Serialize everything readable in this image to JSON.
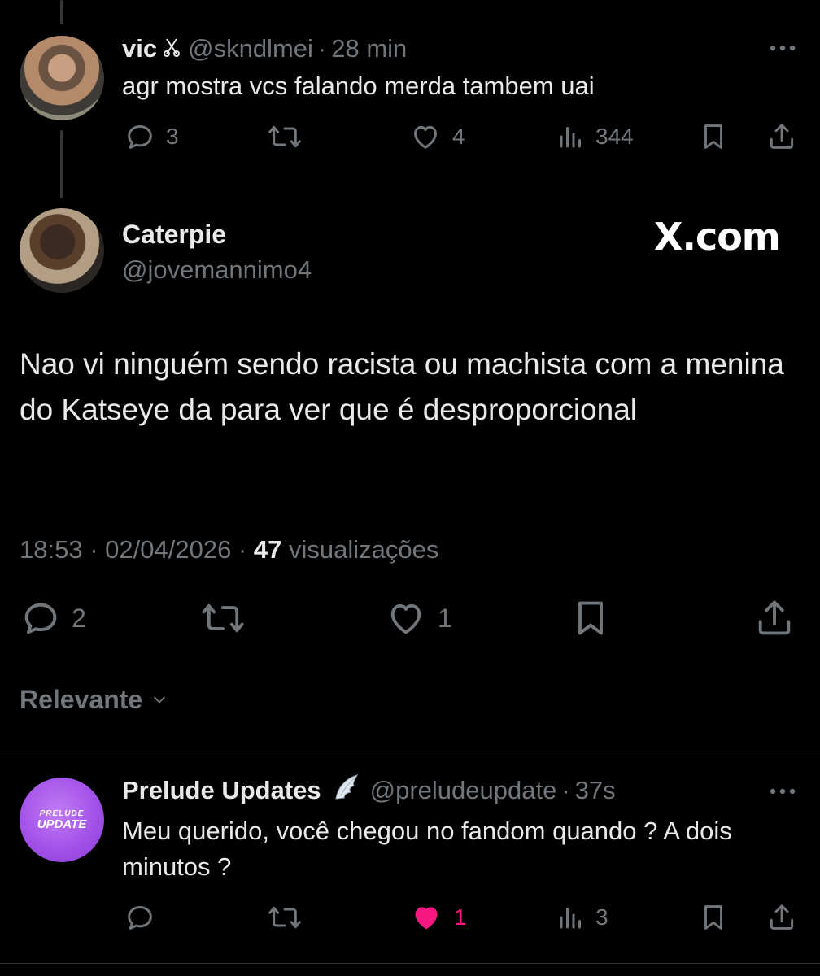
{
  "reply_top": {
    "name": "vic",
    "handle": "@skndlmei",
    "sep": "·",
    "time": "28 min",
    "text": "agr mostra vcs falando merda tambem uai",
    "replies": "3",
    "likes": "4",
    "views": "344"
  },
  "main_tweet": {
    "name": "Caterpie",
    "handle": "@jovemannimo4",
    "brand": "X.com",
    "text": "Nao vi ninguém sendo racista ou machista com a menina do Katseye da para ver que é desproporcional",
    "time": "18:53",
    "date": "02/04/2026",
    "sep": "·",
    "views_count": "47",
    "views_label": "visualizações",
    "replies": "2",
    "likes": "1"
  },
  "sort": {
    "label": "Relevante"
  },
  "reply_bottom": {
    "name": "Prelude Updates",
    "handle": "@preludeupdate",
    "sep": "·",
    "time": "37s",
    "text": "Meu querido, você chegou no fandom quando ? A dois minutos ?",
    "avatar_text_1": "PRELUDE",
    "avatar_text_2": "UPDATE",
    "replies": "",
    "likes": "1",
    "views": "3"
  },
  "colors": {
    "background": "#000000",
    "text": "#e7e9ea",
    "muted": "#71767b",
    "like_active": "#f91880",
    "divider": "#2f3336",
    "avatar_purple": "#b15ff0"
  },
  "icons": [
    "more-icon",
    "reply-icon",
    "retweet-icon",
    "heart-icon",
    "views-icon",
    "bookmark-icon",
    "share-icon",
    "chevron-down-icon",
    "angel-wing-icon",
    "scissors-icon"
  ]
}
